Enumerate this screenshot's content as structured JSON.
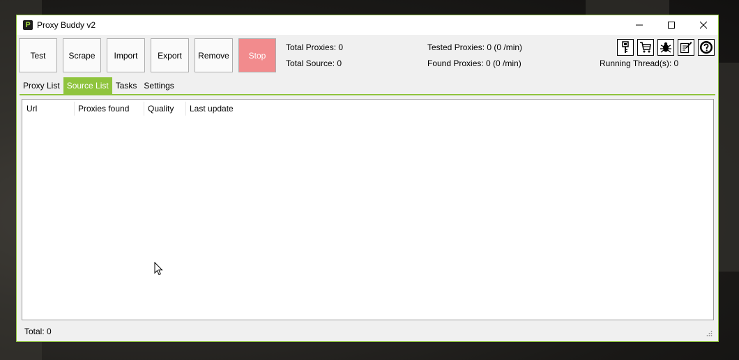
{
  "window": {
    "title": "Proxy Buddy v2",
    "app_icon_letter": "P"
  },
  "toolbar": {
    "buttons": [
      {
        "label": "Test"
      },
      {
        "label": "Scrape"
      },
      {
        "label": "Import"
      },
      {
        "label": "Export"
      },
      {
        "label": "Remove"
      },
      {
        "label": "Stop"
      }
    ]
  },
  "stats": {
    "total_proxies": "Total Proxies: 0",
    "total_source": "Total Source: 0",
    "tested_proxies": "Tested Proxies: 0 (0 /min)",
    "found_proxies": "Found Proxies: 0 (0 /min)",
    "running_threads": "Running Thread(s): 0"
  },
  "tool_icons": [
    "key-icon",
    "cart-icon",
    "bug-icon",
    "edit-icon",
    "help-icon"
  ],
  "tabs": [
    {
      "label": "Proxy List"
    },
    {
      "label": "Source List",
      "active": true
    },
    {
      "label": "Tasks"
    },
    {
      "label": "Settings"
    }
  ],
  "table": {
    "columns": [
      "Url",
      "Proxies found",
      "Quality",
      "Last update"
    ],
    "rows": []
  },
  "status": {
    "total": "Total:  0"
  },
  "colors": {
    "accent": "#8fc43d",
    "stop": "#f28b8d"
  }
}
